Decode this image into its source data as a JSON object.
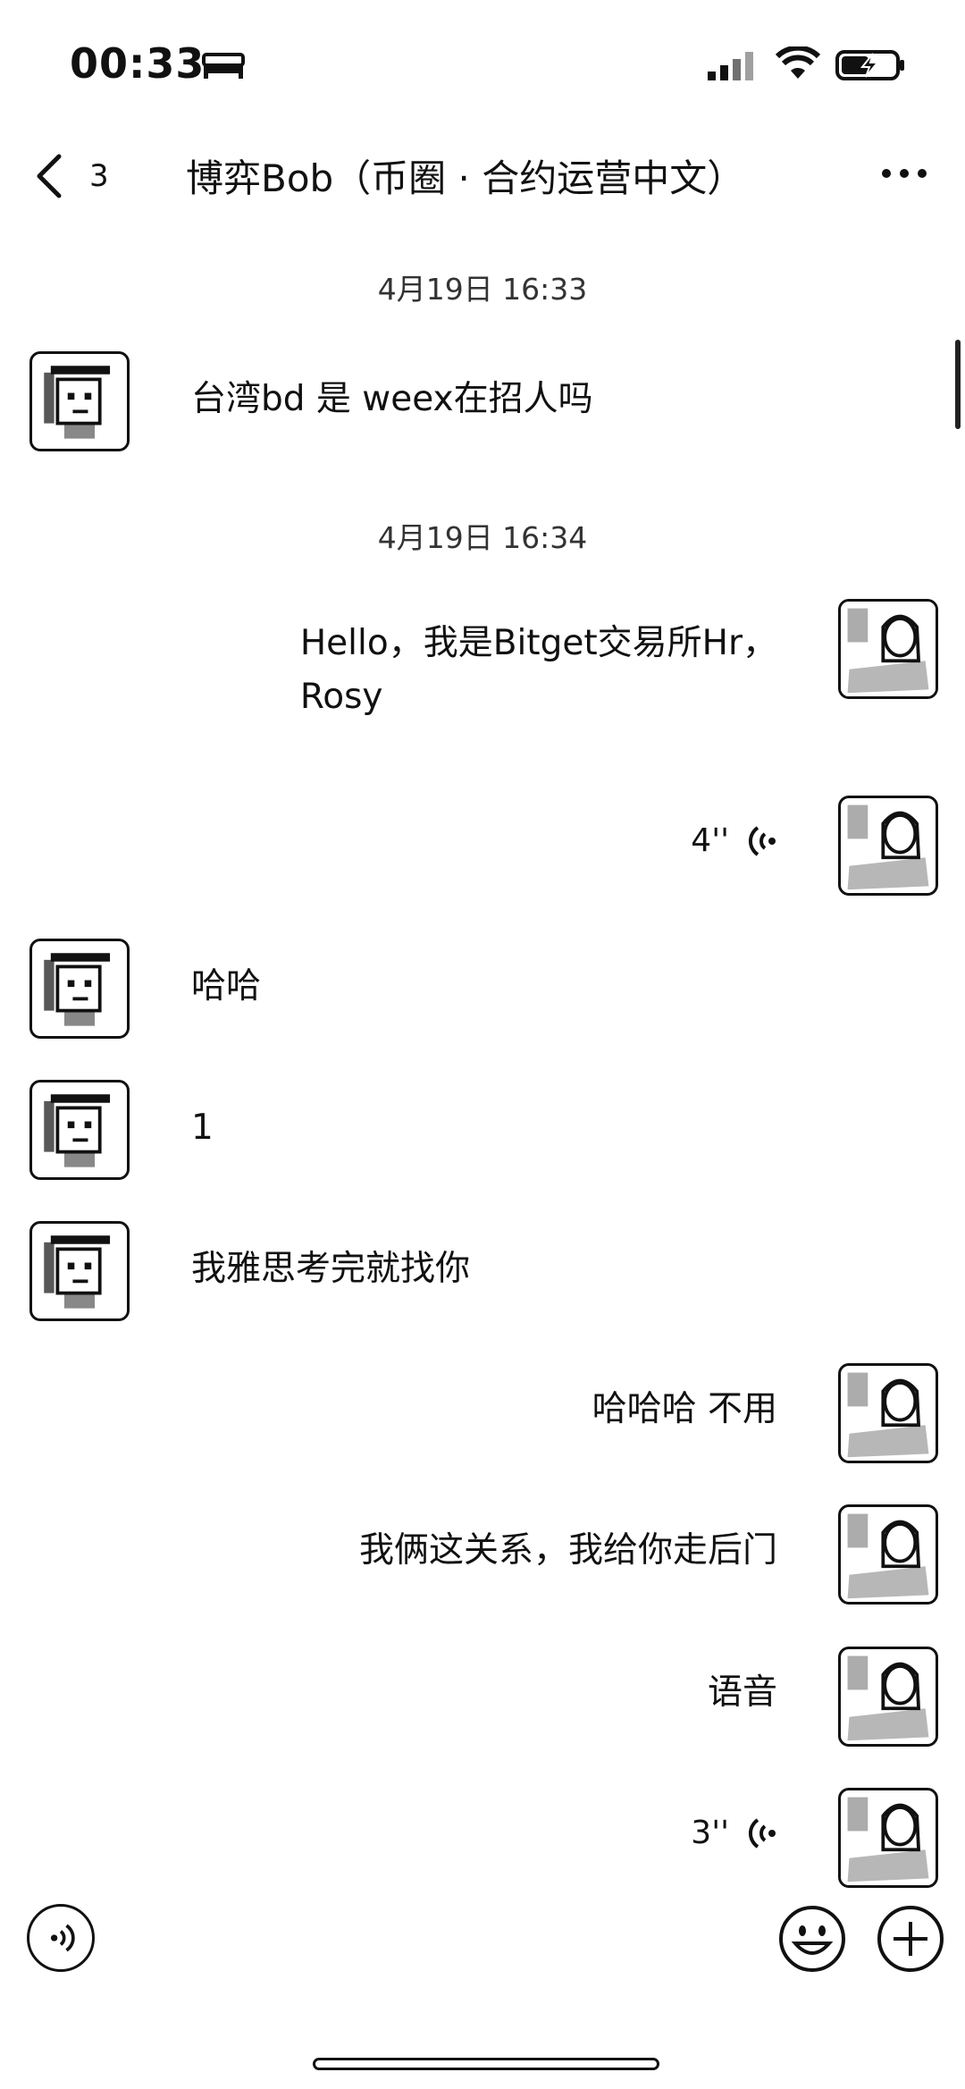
{
  "status_bar": {
    "time": "00:33"
  },
  "nav": {
    "back_count": "3",
    "title": "博弈Bob（币圈 · 合约运营中文）"
  },
  "messages": [
    {
      "type": "timestamp",
      "text": "4月19日 16:33"
    },
    {
      "type": "text",
      "side": "left",
      "text": "台湾bd 是 weex在招人吗"
    },
    {
      "type": "timestamp",
      "text": "4月19日 16:34"
    },
    {
      "type": "text",
      "side": "right",
      "lines": [
        "Hello，我是Bitget交易所Hr，",
        "Rosy"
      ]
    },
    {
      "type": "voice",
      "side": "right",
      "duration": "4''"
    },
    {
      "type": "text",
      "side": "left",
      "text": "哈哈"
    },
    {
      "type": "text",
      "side": "left",
      "text": "1"
    },
    {
      "type": "text",
      "side": "left",
      "text": "我雅思考完就找你"
    },
    {
      "type": "text",
      "side": "right",
      "text": "哈哈哈 不用"
    },
    {
      "type": "text",
      "side": "right",
      "text": "我俩这关系，我给你走后门"
    },
    {
      "type": "text",
      "side": "right",
      "text": "语音"
    },
    {
      "type": "voice",
      "side": "right",
      "duration": "3''"
    }
  ],
  "icons": {
    "back": "chevron-left-icon",
    "more": "more-dots-icon",
    "voice_input": "voice-input-icon",
    "emoji": "emoji-icon",
    "plus": "plus-icon"
  }
}
